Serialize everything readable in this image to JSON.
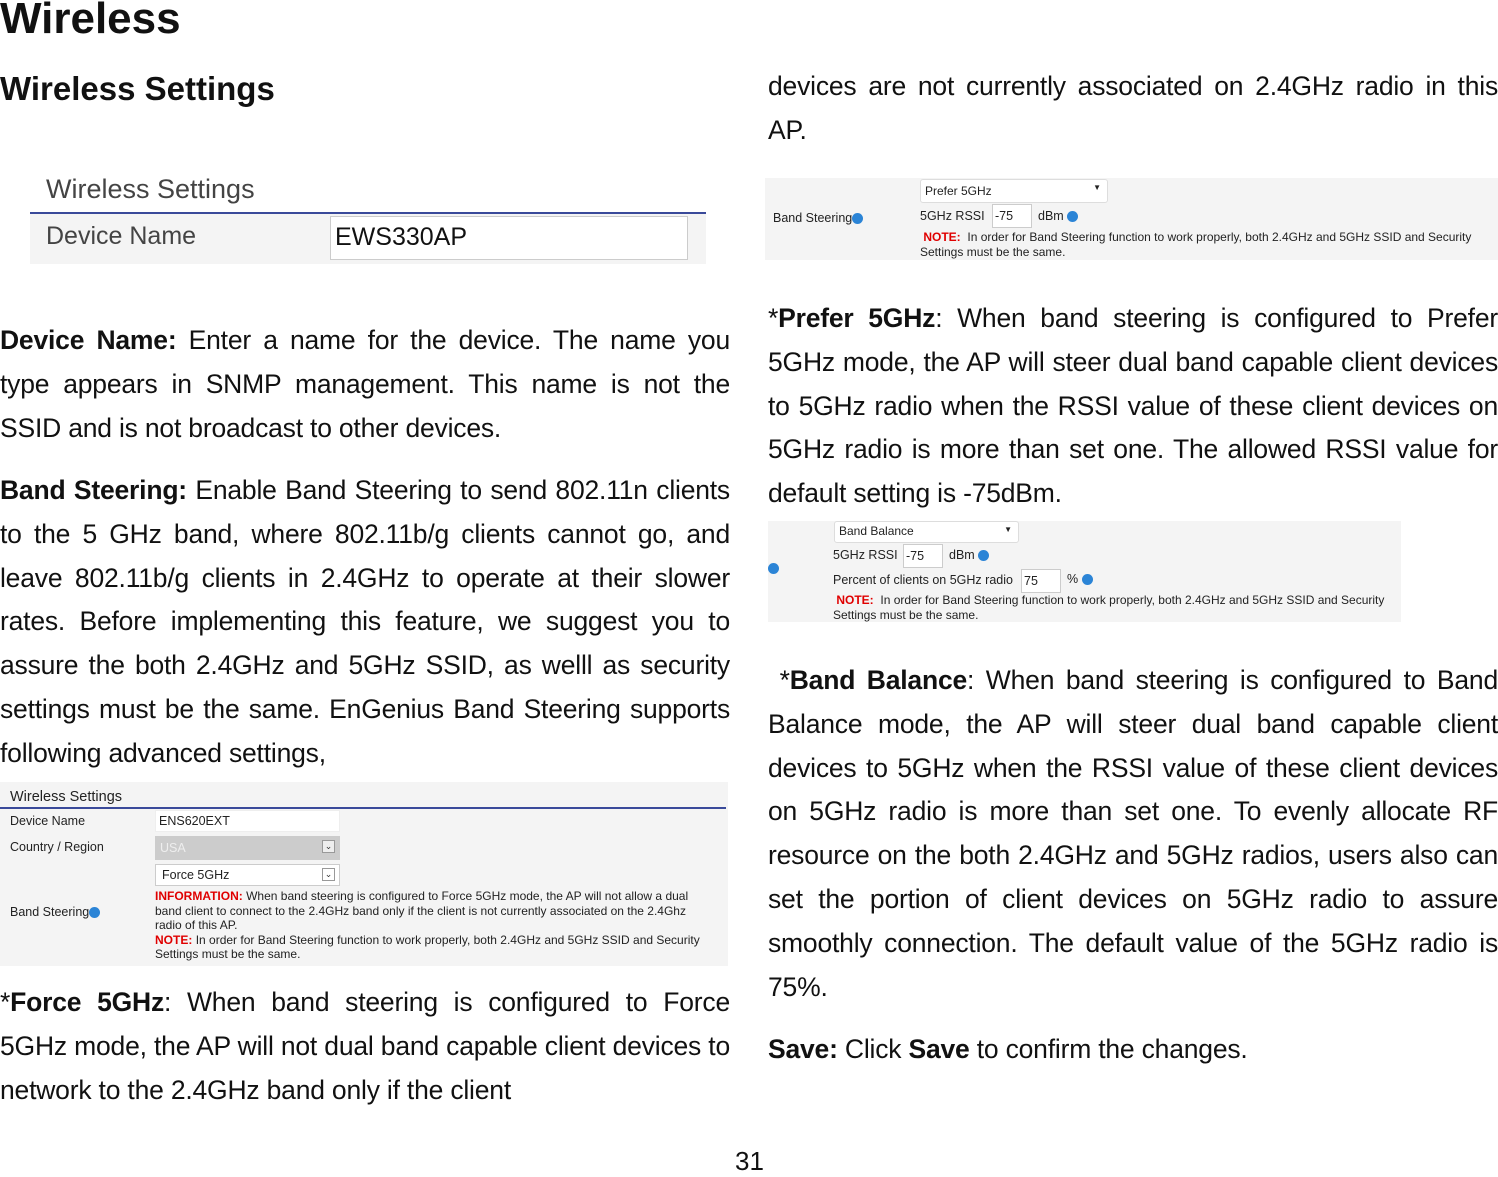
{
  "heading": "Wireless",
  "subheading": "Wireless Settings",
  "shot1": {
    "title": "Wireless Settings",
    "label": "Device Name",
    "value": "EWS330AP"
  },
  "p_device": {
    "term": "Device Name:",
    "text": " Enter a name for the device. The name you type appears in SNMP management. This name is not the SSID and is not broadcast to other devices."
  },
  "p_band": {
    "term": "Band Steering:",
    "text": " Enable Band Steering to send 802.11n clients to the 5 GHz band, where 802.11b/g clients cannot go, and leave 802.11b/g clients in 2.4GHz to operate at their slower rates. Before implementing this feature, we suggest you to assure the both 2.4GHz and 5GHz SSID, as welll as security settings must be the same. EnGenius Band Steering supports following advanced settings,"
  },
  "shot2": {
    "title": "Wireless Settings",
    "device_label": "Device Name",
    "device_value": "ENS620EXT",
    "country_label": "Country / Region",
    "country_value": "USA",
    "band_label": "Band Steering",
    "band_value": "Force 5GHz",
    "info_label": "INFORMATION:",
    "info_text": "When band steering is configured to Force 5GHz mode, the AP will not allow a dual band client to connect to the 2.4GHz band only if the client is not currently associated on the 2.4Ghz radio of this AP.",
    "note_label": "NOTE:",
    "note_text": "In order for Band Steering function to work properly, both 2.4GHz and 5GHz SSID and Security Settings must be the same."
  },
  "p_force": {
    "prefix": "*",
    "term": "Force 5GHz",
    "text": ": When band steering is configured to Force 5GHz mode, the AP will not dual band capable client devices to network to the 2.4GHz band only if the client"
  },
  "p_force_cont": "devices are not currently associated on 2.4GHz radio in this AP.",
  "shot3": {
    "band_label": "Band Steering",
    "mode": "Prefer 5GHz",
    "rssi_label": "5GHz RSSI",
    "rssi_value": "-75",
    "rssi_unit": "dBm",
    "note_label": "NOTE:",
    "note_text": "In order for Band Steering function to work properly, both 2.4GHz and 5GHz SSID and Security Settings must be the same."
  },
  "p_prefer": {
    "prefix": "*",
    "term": "Prefer 5GHz",
    "text": ": When band steering is configured to Prefer 5GHz  mode, the AP will steer dual band capable client devices to 5GHz radio when the RSSI value of these client devices on 5GHz radio is more than set one. The allowed RSSI value for default setting is -75dBm."
  },
  "shot4": {
    "mode": "Band Balance",
    "rssi_label": "5GHz RSSI",
    "rssi_value": "-75",
    "rssi_unit": "dBm",
    "pct_label": "Percent of clients on 5GHz radio",
    "pct_value": "75",
    "pct_unit": "%",
    "note_label": "NOTE:",
    "note_text": "In order for Band Steering function to work properly, both 2.4GHz and 5GHz SSID and Security Settings must be the same."
  },
  "p_balance": {
    "prefix": "*",
    "term": "Band Balance",
    "text": ": When band steering is configured to Band Balance mode, the AP will steer dual band capable client devices to 5GHz when the RSSI value of these client devices on 5GHz radio is more than set one. To evenly allocate RF resource on the both 2.4GHz and 5GHz radios, users also can set the portion of client devices on 5GHz radio to assure smoothly connection. The default value of the 5GHz radio is 75%."
  },
  "p_save": {
    "term": "Save:",
    "text1": " Click ",
    "term2": "Save",
    "text2": " to confirm the changes."
  },
  "page_number": "31",
  "colors": {
    "note_red": "#e00000",
    "info_blue": "#2b84d6",
    "rule_blue": "#3a4a9a"
  }
}
